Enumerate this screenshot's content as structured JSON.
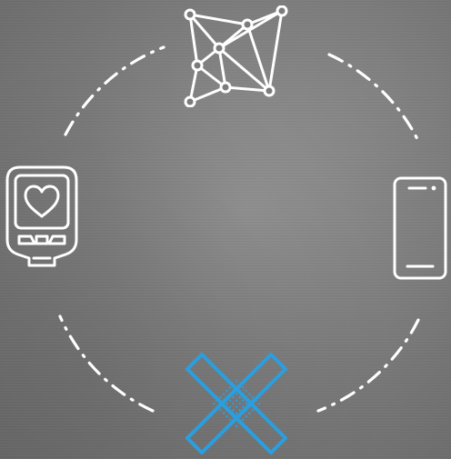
{
  "diagram": {
    "nodes": [
      {
        "icon": "network-mesh-icon",
        "position": "top"
      },
      {
        "icon": "smartphone-icon",
        "position": "right"
      },
      {
        "icon": "bandage-icon",
        "position": "bottom"
      },
      {
        "icon": "glucose-meter-heart-icon",
        "position": "left"
      }
    ],
    "connector_style": "dash-dot circle"
  },
  "colors": {
    "background": "#7c7c7c",
    "line": "#ffffff",
    "accent": "#2a9fe0"
  }
}
